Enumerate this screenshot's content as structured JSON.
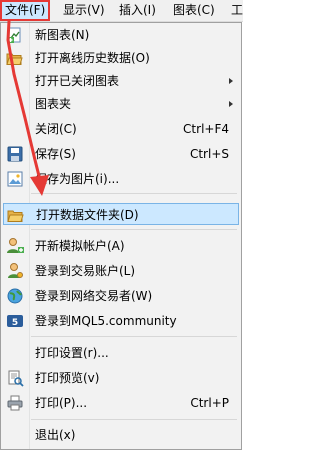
{
  "menubar": {
    "items": [
      {
        "label": "文件(F)"
      },
      {
        "label": "显示(V)"
      },
      {
        "label": "插入(I)"
      },
      {
        "label": "图表(C)"
      },
      {
        "label": "工"
      }
    ]
  },
  "menu": {
    "new_chart": {
      "label": "新图表(N)"
    },
    "open_offline": {
      "label": "打开离线历史数据(O)"
    },
    "open_closed": {
      "label": "打开已关闭图表"
    },
    "chart_folder": {
      "label": "图表夹"
    },
    "close": {
      "label": "关闭(C)",
      "shortcut": "Ctrl+F4"
    },
    "save": {
      "label": "保存(S)",
      "shortcut": "Ctrl+S"
    },
    "save_picture": {
      "label": "保存为图片(i)..."
    },
    "open_data_folder": {
      "label": "打开数据文件夹(D)"
    },
    "open_demo": {
      "label": "开新模拟帐户(A)"
    },
    "login_trade": {
      "label": "登录到交易账户(L)"
    },
    "login_web": {
      "label": "登录到网络交易者(W)"
    },
    "login_mql5": {
      "label": "登录到MQL5.community"
    },
    "print_setup": {
      "label": "打印设置(r)..."
    },
    "print_preview": {
      "label": "打印预览(v)"
    },
    "print": {
      "label": "打印(P)...",
      "shortcut": "Ctrl+P"
    },
    "exit": {
      "label": "退出(x)"
    }
  },
  "colors": {
    "highlight": "#cce8ff",
    "annotation_red": "#e53935"
  }
}
